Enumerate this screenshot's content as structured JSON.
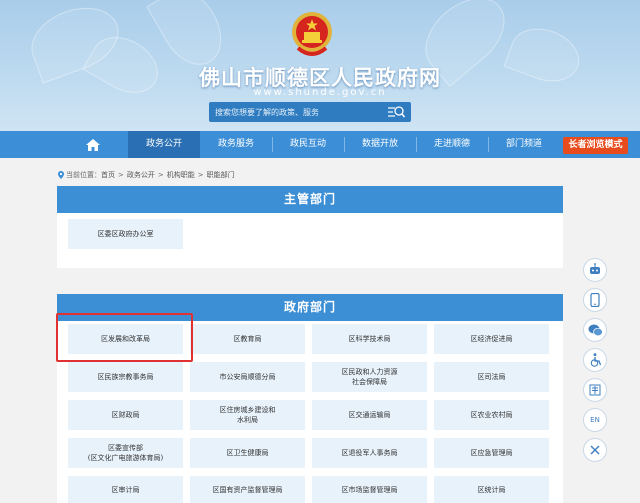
{
  "header": {
    "title": "佛山市顺德区人民政府网",
    "url": "www.shunde.gov.cn",
    "search_placeholder": "搜索您想要了解的政策、服务"
  },
  "nav": {
    "items": [
      {
        "label": "政务公开",
        "active": true
      },
      {
        "label": "政务服务"
      },
      {
        "label": "政民互动"
      },
      {
        "label": "数据开放"
      },
      {
        "label": "走进顺德"
      },
      {
        "label": "部门频道"
      }
    ],
    "elder_mode": "长者浏览模式"
  },
  "breadcrumb": {
    "prefix": "当前位置：",
    "items": [
      "首页",
      "政务公开",
      "机构职能",
      "职能部门"
    ]
  },
  "panels": {
    "main": {
      "title": "主管部门",
      "items": [
        "区委区政府办公室"
      ]
    },
    "gov": {
      "title": "政府部门",
      "items": [
        "区发展和改革局",
        "区教育局",
        "区科学技术局",
        "区经济促进局",
        "区民族宗教事务局",
        "市公安局顺德分局",
        "区民政和人力资源\n社会保障局",
        "区司法局",
        "区财政局",
        "区住房城乡建设和\n水利局",
        "区交通运输局",
        "区农业农村局",
        "区委宣传部\n(区文化广电旅游体育局)",
        "区卫生健康局",
        "区退役军人事务局",
        "区应急管理局",
        "区审计局",
        "区国有资产监督管理局",
        "区市场监督管理局",
        "区统计局"
      ]
    }
  },
  "sidebar": {
    "en_label": "EN"
  },
  "colors": {
    "nav_bg": "#3c8fd6",
    "nav_active": "#2a6fb3",
    "panel_head": "#3d8fd5",
    "cell_bg": "#e7f2fb",
    "elder_btn": "#e84b1c",
    "highlight": "#e03232"
  }
}
